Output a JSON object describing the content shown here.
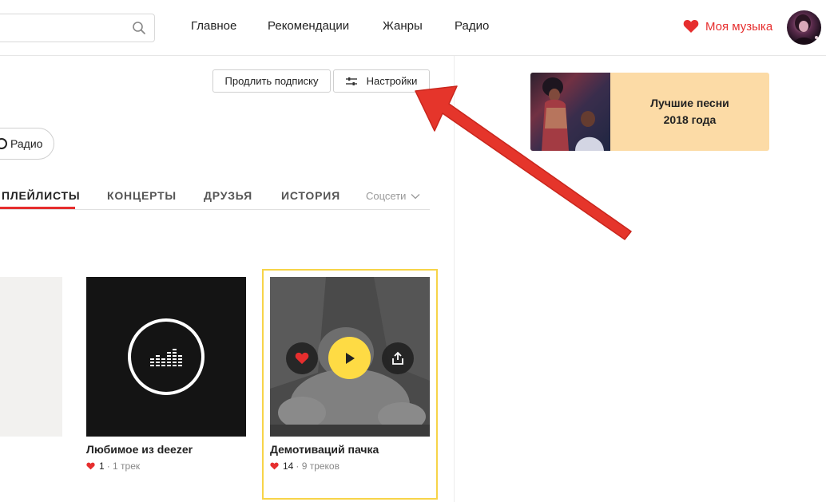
{
  "header": {
    "search": {
      "placeholder": "ь"
    },
    "nav": [
      {
        "label": "Главное"
      },
      {
        "label": "Рекомендации"
      },
      {
        "label": "Жанры"
      },
      {
        "label": "Радио"
      }
    ],
    "my_music_label": "Моя музыка"
  },
  "actions": {
    "extend_label": "Продлить подписку",
    "settings_label": "Настройки",
    "radio_label": "Радио"
  },
  "tabs": {
    "items": [
      {
        "label": "ПЛЕЙЛИСТЫ",
        "active": true
      },
      {
        "label": "КОНЦЕРТЫ"
      },
      {
        "label": "ДРУЗЬЯ"
      },
      {
        "label": "ИСТОРИЯ"
      }
    ],
    "social_label": "Соцсети"
  },
  "playlists": [
    {
      "title": "Любимое из deezer",
      "likes": "1",
      "tracks": "· 1 трек"
    },
    {
      "title": "Демотиваций пачка",
      "likes": "14",
      "tracks": "· 9 треков"
    }
  ],
  "promo": {
    "line1": "Лучшие песни",
    "line2": "2018 года"
  },
  "colors": {
    "accent_red": "#e62e2e",
    "play_yellow": "#fedb44",
    "selected_frame": "#f7d448",
    "promo_bg": "#fcdba6",
    "annotation_arrow": "#e5352b"
  }
}
